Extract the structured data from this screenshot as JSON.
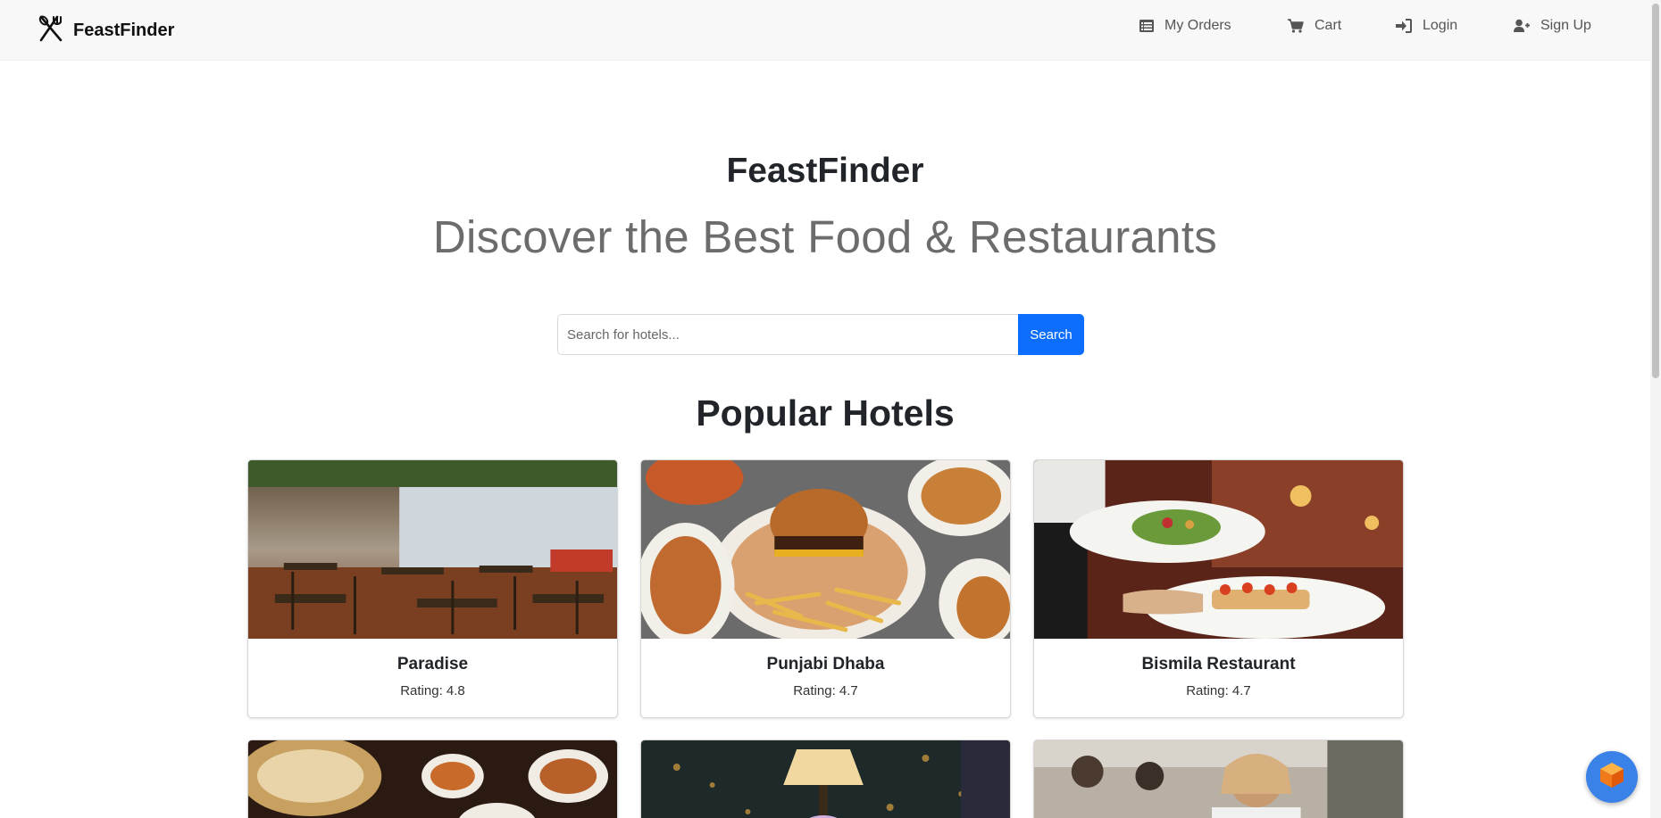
{
  "navbar": {
    "brand": "FeastFinder",
    "items": [
      {
        "label": "My Orders",
        "icon": "list-icon"
      },
      {
        "label": "Cart",
        "icon": "cart-icon"
      },
      {
        "label": "Login",
        "icon": "login-icon"
      },
      {
        "label": "Sign Up",
        "icon": "user-plus-icon"
      }
    ]
  },
  "hero": {
    "title": "FeastFinder",
    "subtitle": "Discover the Best Food & Restaurants"
  },
  "search": {
    "placeholder": "Search for hotels...",
    "button": "Search"
  },
  "section": {
    "title": "Popular Hotels"
  },
  "hotels": [
    {
      "name": "Paradise",
      "rating": "Rating: 4.8"
    },
    {
      "name": "Punjabi Dhaba",
      "rating": "Rating: 4.7"
    },
    {
      "name": "Bismila Restaurant",
      "rating": "Rating: 4.7"
    }
  ],
  "colors": {
    "accent": "#0d6efd",
    "navbar_bg": "#f8f8f8",
    "fab": "#3b82e8"
  }
}
